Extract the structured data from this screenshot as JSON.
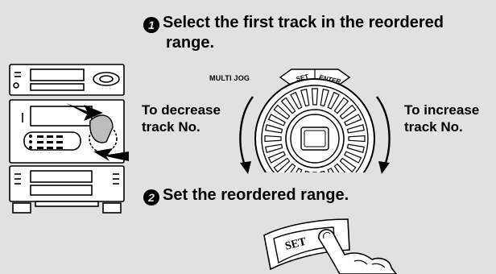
{
  "step1": {
    "number": "1",
    "line1": "Select the first track in the reordered",
    "line2": "range."
  },
  "step2": {
    "number": "2",
    "text": "Set the reordered range."
  },
  "jog": {
    "label": "MULTI JOG",
    "set_label": "SET",
    "enter_label": "ENTER"
  },
  "decrease": {
    "line1": "To decrease",
    "line2": "track No."
  },
  "increase": {
    "line1": "To increase",
    "line2": "track No."
  },
  "set_button": {
    "label": "SET"
  }
}
